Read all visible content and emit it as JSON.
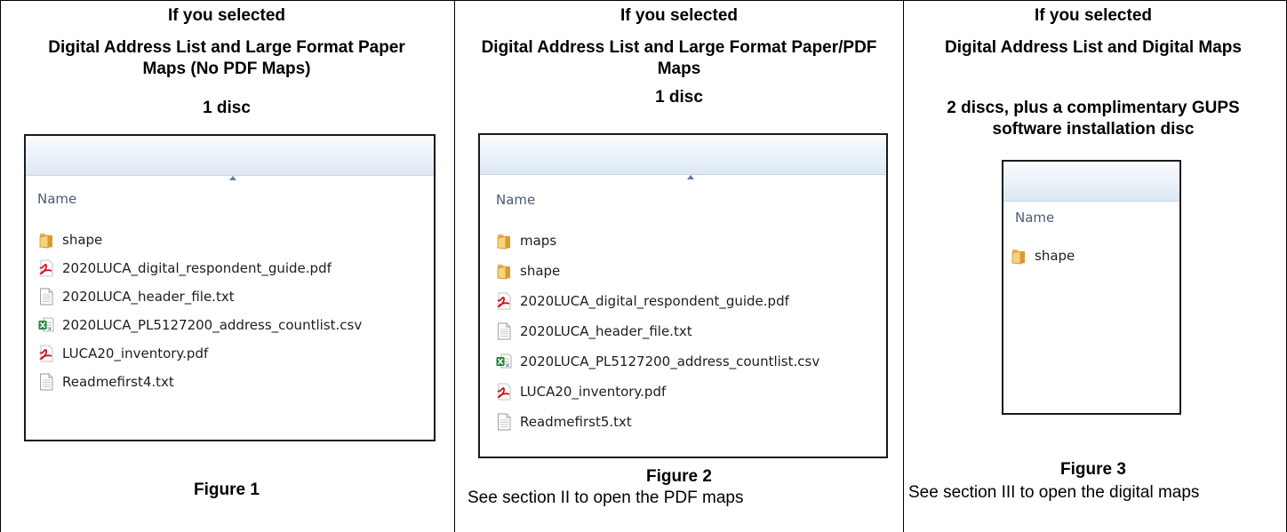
{
  "columns": [
    {
      "heading": {
        "line1": "If you selected",
        "line2": "Digital Address List and Large Format Paper Maps (No PDF Maps)",
        "line3": "1 disc"
      },
      "explorer": {
        "column_header": "Name",
        "items": [
          {
            "icon": "folder-icon",
            "label": "shape"
          },
          {
            "icon": "pdf-file-icon",
            "label": "2020LUCA_digital_respondent_guide.pdf"
          },
          {
            "icon": "text-file-icon",
            "label": "2020LUCA_header_file.txt"
          },
          {
            "icon": "excel-csv-file-icon",
            "label": "2020LUCA_PL5127200_address_countlist.csv"
          },
          {
            "icon": "pdf-file-icon",
            "label": "LUCA20_inventory.pdf"
          },
          {
            "icon": "text-file-icon",
            "label": "Readmefirst4.txt"
          }
        ]
      },
      "figure_caption": "Figure 1",
      "note": ""
    },
    {
      "heading": {
        "line1": "If you selected",
        "line2": "Digital Address List and Large Format Paper/PDF Maps",
        "line3": "1 disc"
      },
      "explorer": {
        "column_header": "Name",
        "items": [
          {
            "icon": "folder-icon",
            "label": "maps"
          },
          {
            "icon": "folder-icon",
            "label": "shape"
          },
          {
            "icon": "pdf-file-icon",
            "label": "2020LUCA_digital_respondent_guide.pdf"
          },
          {
            "icon": "text-file-icon",
            "label": "2020LUCA_header_file.txt"
          },
          {
            "icon": "excel-csv-file-icon",
            "label": "2020LUCA_PL5127200_address_countlist.csv"
          },
          {
            "icon": "pdf-file-icon",
            "label": "LUCA20_inventory.pdf"
          },
          {
            "icon": "text-file-icon",
            "label": "Readmefirst5.txt"
          }
        ]
      },
      "figure_caption": "Figure 2",
      "note": "See section II to open the PDF maps"
    },
    {
      "heading": {
        "line1": "If you selected",
        "line2": "Digital Address List and Digital Maps",
        "line3": "2 discs, plus a complimentary GUPS software installation disc"
      },
      "explorer": {
        "column_header": "Name",
        "items": [
          {
            "icon": "folder-icon",
            "label": "shape"
          }
        ]
      },
      "figure_caption": "Figure 3",
      "note": "See section III to open the digital maps"
    }
  ]
}
